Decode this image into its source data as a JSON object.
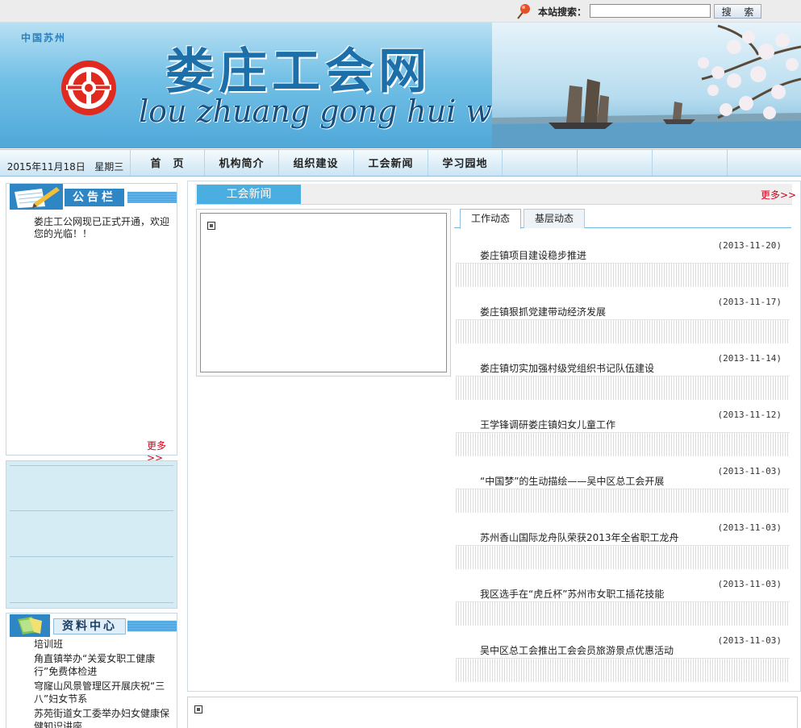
{
  "topbar": {
    "search_label": "本站搜索：",
    "search_value": "",
    "search_button": "搜 索",
    "icon": "map-pin-icon"
  },
  "banner": {
    "region": "中国苏州",
    "title": "娄庄工会网",
    "pinyin": "lou zhuang gong hui wang",
    "logo_icon": "trade-union-logo-icon"
  },
  "nav": {
    "date": "2015年11月18日",
    "weekday": "星期三",
    "items": [
      {
        "label": "首　页"
      },
      {
        "label": "机构简介"
      },
      {
        "label": "组织建设"
      },
      {
        "label": "工会新闻"
      },
      {
        "label": "学习园地"
      }
    ]
  },
  "notice": {
    "title": "公告栏",
    "text": "娄庄工公网现已正式开通，欢迎您的光临！！",
    "more": "更多>>"
  },
  "resources": {
    "title": "资料中心",
    "items": [
      "培训班",
      "角直镇举办“关爱女职工健康行”免费体检进",
      "穹窿山风景管理区开展庆祝“三八”妇女节系",
      "苏苑街道女工委举办妇女健康保健知识讲座"
    ]
  },
  "news": {
    "section_title": "工会新闻",
    "more": "更多>>",
    "tabs": [
      {
        "label": "工作动态",
        "active": true
      },
      {
        "label": "基层动态",
        "active": false
      }
    ],
    "items": [
      {
        "title": "娄庄镇项目建设稳步推进",
        "date": "(2013-11-20)"
      },
      {
        "title": "娄庄镇狠抓党建带动经济发展",
        "date": "(2013-11-17)"
      },
      {
        "title": "娄庄镇切实加强村级党组织书记队伍建设",
        "date": "(2013-11-14)"
      },
      {
        "title": "王学锋调研娄庄镇妇女儿童工作",
        "date": "(2013-11-12)"
      },
      {
        "title": "“中国梦”的生动描绘——吴中区总工会开展",
        "date": "(2013-11-03)"
      },
      {
        "title": "苏州香山国际龙舟队荣获2013年全省职工龙舟",
        "date": "(2013-11-03)"
      },
      {
        "title": "我区选手在“虎丘杯”苏州市女职工插花技能",
        "date": "(2013-11-03)"
      },
      {
        "title": "吴中区总工会推出工会会员旅游景点优惠活动",
        "date": "(2013-11-03)"
      }
    ]
  }
}
